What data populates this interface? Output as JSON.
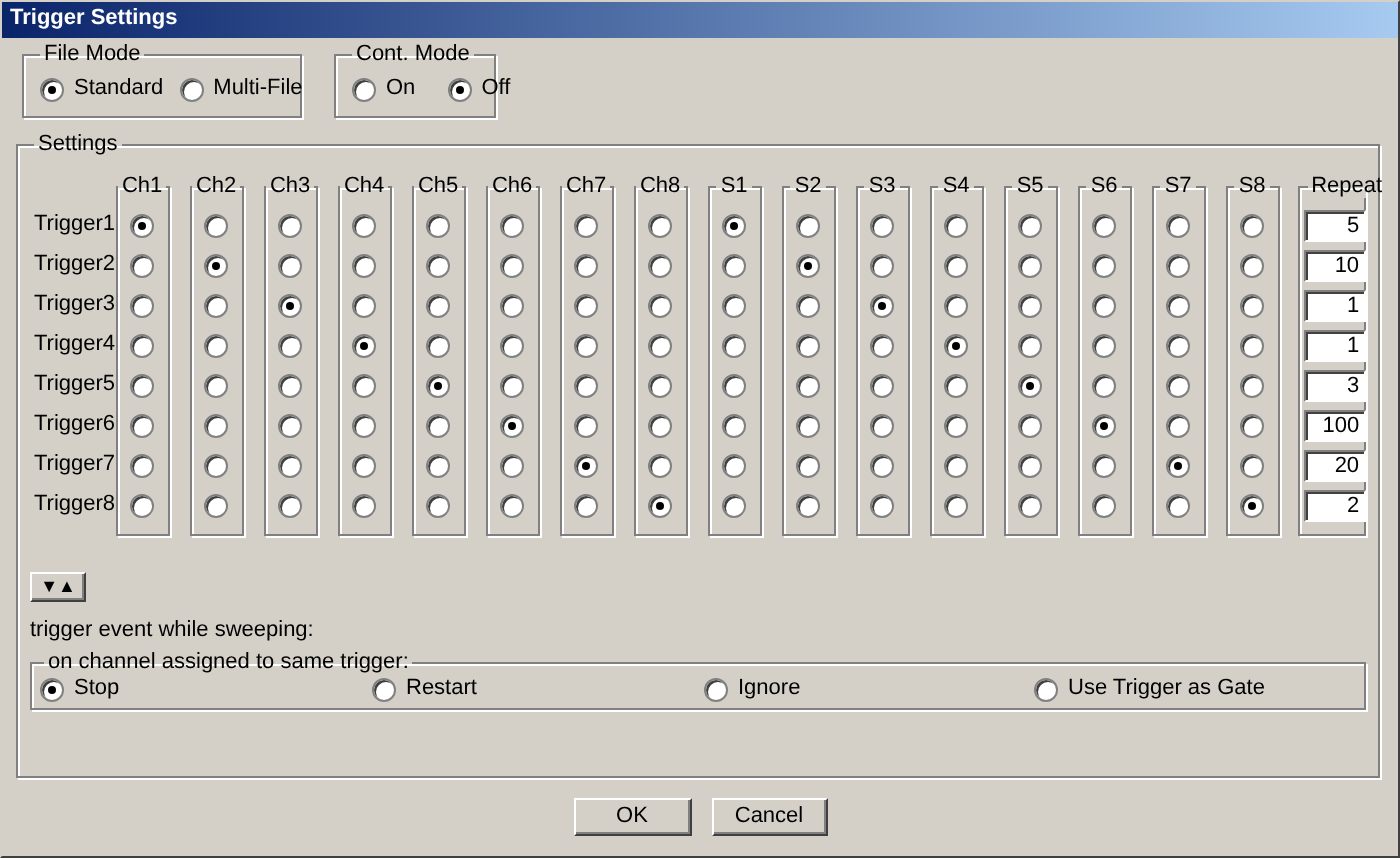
{
  "window": {
    "title": "Trigger Settings"
  },
  "file_mode": {
    "label": "File Mode",
    "options": [
      {
        "label": "Standard",
        "selected": true
      },
      {
        "label": "Multi-File",
        "selected": false
      }
    ]
  },
  "cont_mode": {
    "label": "Cont. Mode",
    "options": [
      {
        "label": "On",
        "selected": false
      },
      {
        "label": "Off",
        "selected": true
      }
    ]
  },
  "settings": {
    "label": "Settings",
    "columns": [
      "Ch1",
      "Ch2",
      "Ch3",
      "Ch4",
      "Ch5",
      "Ch6",
      "Ch7",
      "Ch8",
      "S1",
      "S2",
      "S3",
      "S4",
      "S5",
      "S6",
      "S7",
      "S8"
    ],
    "repeat_label": "Repeat",
    "triggers": [
      {
        "label": "Trigger1",
        "repeat": "5",
        "cells": [
          {
            "selected": true
          },
          {
            "selected": false
          },
          {
            "selected": false
          },
          {
            "selected": false
          },
          {
            "selected": false
          },
          {
            "selected": false
          },
          {
            "selected": false
          },
          {
            "selected": false
          },
          {
            "selected": true
          },
          {
            "selected": false
          },
          {
            "selected": false
          },
          {
            "selected": false
          },
          {
            "selected": false
          },
          {
            "selected": false
          },
          {
            "selected": false
          },
          {
            "selected": false
          }
        ]
      },
      {
        "label": "Trigger2",
        "repeat": "10",
        "cells": [
          {
            "selected": false
          },
          {
            "selected": true
          },
          {
            "selected": false
          },
          {
            "selected": false
          },
          {
            "selected": false
          },
          {
            "selected": false
          },
          {
            "selected": false
          },
          {
            "selected": false
          },
          {
            "selected": false
          },
          {
            "selected": true
          },
          {
            "selected": false
          },
          {
            "selected": false
          },
          {
            "selected": false
          },
          {
            "selected": false
          },
          {
            "selected": false
          },
          {
            "selected": false
          }
        ]
      },
      {
        "label": "Trigger3",
        "repeat": "1",
        "cells": [
          {
            "selected": false
          },
          {
            "selected": false
          },
          {
            "selected": true
          },
          {
            "selected": false
          },
          {
            "selected": false
          },
          {
            "selected": false
          },
          {
            "selected": false
          },
          {
            "selected": false
          },
          {
            "selected": false
          },
          {
            "selected": false
          },
          {
            "selected": true
          },
          {
            "selected": false
          },
          {
            "selected": false
          },
          {
            "selected": false
          },
          {
            "selected": false
          },
          {
            "selected": false
          }
        ]
      },
      {
        "label": "Trigger4",
        "repeat": "1",
        "cells": [
          {
            "selected": false
          },
          {
            "selected": false
          },
          {
            "selected": false
          },
          {
            "selected": true
          },
          {
            "selected": false
          },
          {
            "selected": false
          },
          {
            "selected": false
          },
          {
            "selected": false
          },
          {
            "selected": false
          },
          {
            "selected": false
          },
          {
            "selected": false
          },
          {
            "selected": true
          },
          {
            "selected": false
          },
          {
            "selected": false
          },
          {
            "selected": false
          },
          {
            "selected": false
          }
        ]
      },
      {
        "label": "Trigger5",
        "repeat": "3",
        "cells": [
          {
            "selected": false
          },
          {
            "selected": false
          },
          {
            "selected": false
          },
          {
            "selected": false
          },
          {
            "selected": true
          },
          {
            "selected": false
          },
          {
            "selected": false
          },
          {
            "selected": false
          },
          {
            "selected": false
          },
          {
            "selected": false
          },
          {
            "selected": false
          },
          {
            "selected": false
          },
          {
            "selected": true
          },
          {
            "selected": false
          },
          {
            "selected": false
          },
          {
            "selected": false
          }
        ]
      },
      {
        "label": "Trigger6",
        "repeat": "100",
        "cells": [
          {
            "selected": false
          },
          {
            "selected": false
          },
          {
            "selected": false
          },
          {
            "selected": false
          },
          {
            "selected": false
          },
          {
            "selected": true
          },
          {
            "selected": false
          },
          {
            "selected": false
          },
          {
            "selected": false
          },
          {
            "selected": false
          },
          {
            "selected": false
          },
          {
            "selected": false
          },
          {
            "selected": false
          },
          {
            "selected": true
          },
          {
            "selected": false
          },
          {
            "selected": false
          }
        ]
      },
      {
        "label": "Trigger7",
        "repeat": "20",
        "cells": [
          {
            "selected": false
          },
          {
            "selected": false
          },
          {
            "selected": false
          },
          {
            "selected": false
          },
          {
            "selected": false
          },
          {
            "selected": false
          },
          {
            "selected": true
          },
          {
            "selected": false
          },
          {
            "selected": false
          },
          {
            "selected": false
          },
          {
            "selected": false
          },
          {
            "selected": false
          },
          {
            "selected": false
          },
          {
            "selected": false
          },
          {
            "selected": true
          },
          {
            "selected": false
          }
        ]
      },
      {
        "label": "Trigger8",
        "repeat": "2",
        "cells": [
          {
            "selected": false
          },
          {
            "selected": false
          },
          {
            "selected": false
          },
          {
            "selected": false
          },
          {
            "selected": false
          },
          {
            "selected": false
          },
          {
            "selected": false
          },
          {
            "selected": true
          },
          {
            "selected": false
          },
          {
            "selected": false
          },
          {
            "selected": false
          },
          {
            "selected": false
          },
          {
            "selected": false
          },
          {
            "selected": false
          },
          {
            "selected": false
          },
          {
            "selected": true
          }
        ]
      }
    ],
    "toggle_button": "▼▲",
    "sweep_label": "trigger event while sweeping:",
    "same_trigger": {
      "label": "on channel assigned to same trigger:",
      "options": [
        {
          "label": "Stop",
          "selected": true
        },
        {
          "label": "Restart",
          "selected": false
        },
        {
          "label": "Ignore",
          "selected": false
        },
        {
          "label": "Use Trigger as Gate",
          "selected": false
        }
      ]
    }
  },
  "buttons": [
    "OK",
    "Cancel"
  ]
}
